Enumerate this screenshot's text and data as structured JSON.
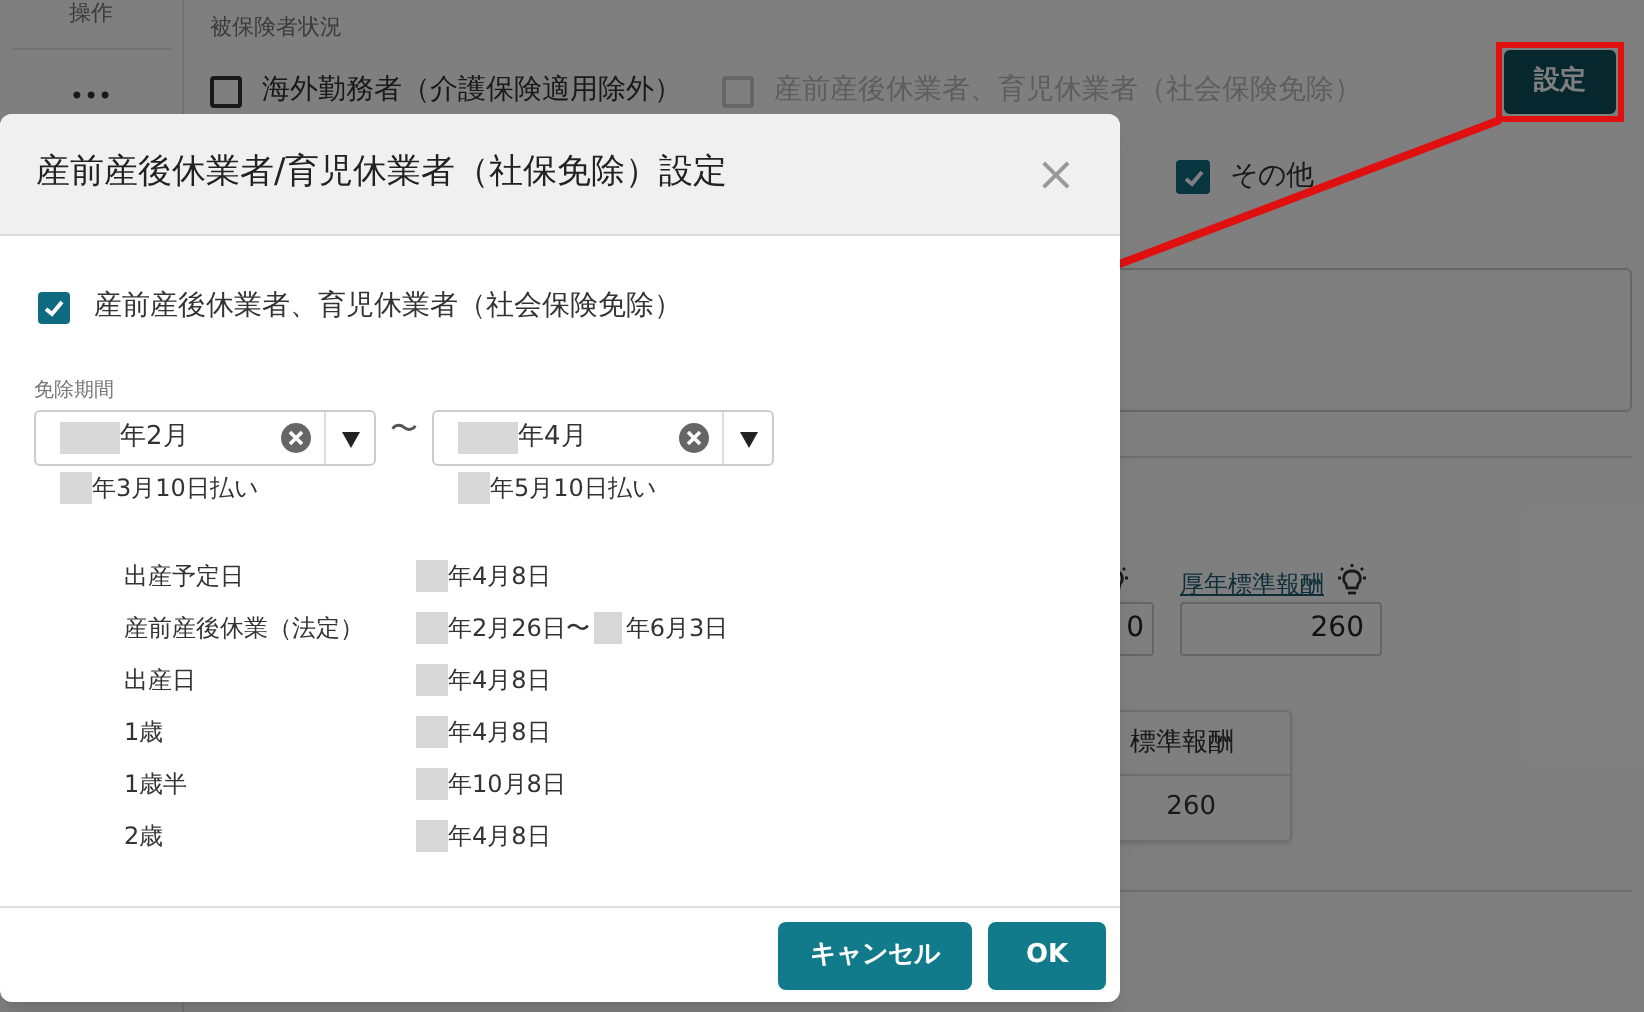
{
  "background": {
    "column_header": "操作",
    "more_menu": "•••",
    "section_label": "被保険者状況",
    "checkboxes": [
      {
        "label": "海外勤務者（介護保険適用除外）",
        "checked": false,
        "disabled": false
      },
      {
        "label": "産前産後休業者、育児休業者（社会保険免除）",
        "checked": false,
        "disabled": true
      }
    ],
    "settings_button": "設定",
    "other_checkbox": {
      "label": "その他",
      "checked": true
    },
    "partial_field_value": "0",
    "pension_field": {
      "label": "厚年標準報酬",
      "value": "260"
    },
    "table": {
      "header": "標準報酬",
      "cell": "260"
    }
  },
  "dialog": {
    "title": "産前産後休業者/育児休業者（社保免除）設定",
    "close": "×",
    "exempt_checkbox": {
      "label": "産前産後休業者、育児休業者（社会保険免除）",
      "checked": true
    },
    "period_label": "免除期間",
    "range_separator": "〜",
    "period": [
      {
        "value": "年2月",
        "note": "年3月10日払い"
      },
      {
        "value": "年4月",
        "note": "年5月10日払い"
      }
    ],
    "details": [
      {
        "label": "出産予定日",
        "value": [
          "年4月8日"
        ]
      },
      {
        "label": "産前産後休業（法定）",
        "value": [
          "年2月26日〜",
          "年6月3日"
        ]
      },
      {
        "label": "出産日",
        "value": [
          "年4月8日"
        ]
      },
      {
        "label": "1歳",
        "value": [
          "年4月8日"
        ]
      },
      {
        "label": "1歳半",
        "value": [
          "年10月8日"
        ]
      },
      {
        "label": "2歳",
        "value": [
          "年4月8日"
        ]
      }
    ],
    "buttons": [
      {
        "label": "キャンセル"
      },
      {
        "label": "OK"
      }
    ]
  }
}
